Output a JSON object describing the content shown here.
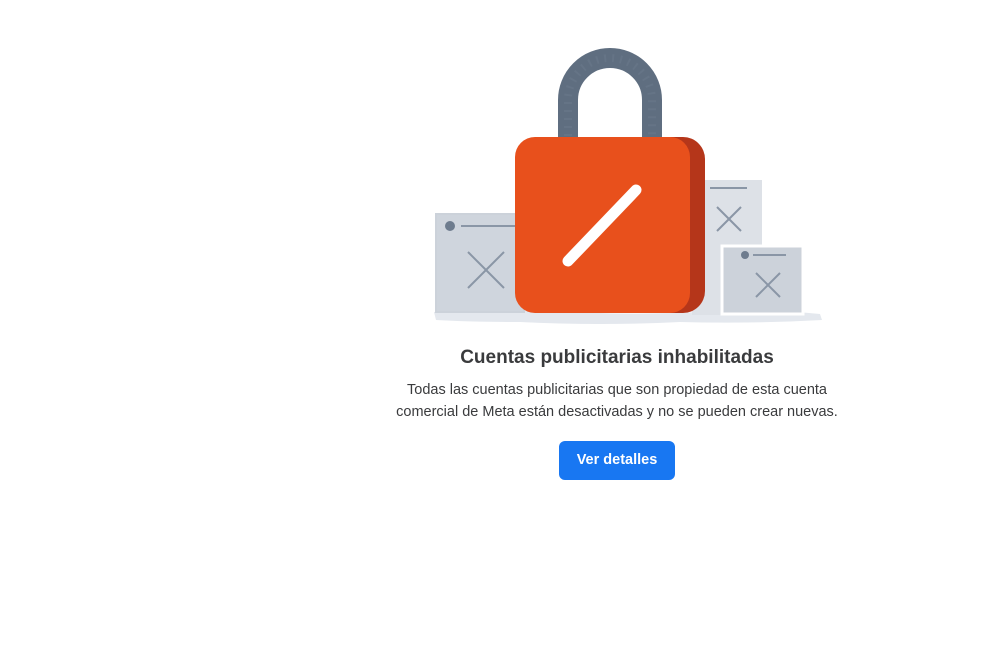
{
  "empty_state": {
    "title": "Cuentas publicitarias inhabilitadas",
    "description": "Todas las cuentas publicitarias que son propiedad de esta cuenta comercial de Meta están desactivadas y no se pueden crear nuevas.",
    "button_label": "Ver detalles",
    "illustration_icon": "disabled-lock-icon"
  },
  "colors": {
    "primary_button": "#1877f2",
    "lock_body": "#e8501c",
    "lock_shackle": "#5f6e80",
    "card_background": "#ccd2da",
    "text": "#3a3b3d"
  }
}
